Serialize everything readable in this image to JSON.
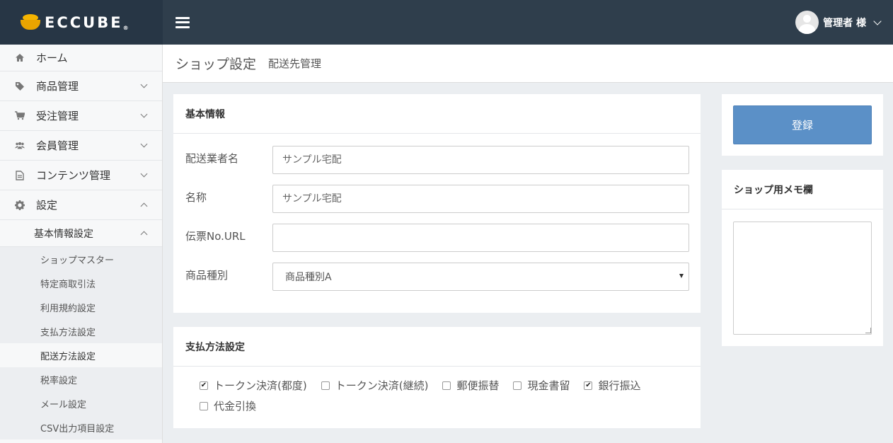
{
  "header": {
    "brand": "ECCUBE",
    "brand_mark": "®",
    "user_label": "管理者 様"
  },
  "sidebar": {
    "items": [
      {
        "label": "ホーム",
        "icon": "home-icon"
      },
      {
        "label": "商品管理",
        "icon": "tag-icon"
      },
      {
        "label": "受注管理",
        "icon": "cart-icon"
      },
      {
        "label": "会員管理",
        "icon": "users-icon"
      },
      {
        "label": "コンテンツ管理",
        "icon": "file-icon"
      },
      {
        "label": "設定",
        "icon": "gear-icon"
      }
    ],
    "sub_head": "基本情報設定",
    "sub_items": [
      {
        "label": "ショップマスター"
      },
      {
        "label": "特定商取引法"
      },
      {
        "label": "利用規約設定"
      },
      {
        "label": "支払方法設定"
      },
      {
        "label": "配送方法設定",
        "active": true
      },
      {
        "label": "税率設定"
      },
      {
        "label": "メール設定"
      },
      {
        "label": "CSV出力項目設定"
      }
    ]
  },
  "page": {
    "title": "ショップ設定",
    "subtitle": "配送先管理"
  },
  "basic_info": {
    "heading": "基本情報",
    "carrier_label": "配送業者名",
    "carrier_placeholder": "サンプル宅配",
    "name_label": "名称",
    "name_placeholder": "サンプル宅配",
    "tracking_label": "伝票No.URL",
    "tracking_value": "",
    "product_type_label": "商品種別",
    "product_type_selected": "商品種別A"
  },
  "payment": {
    "heading": "支払方法設定",
    "options": [
      {
        "label": "トークン決済(都度)",
        "checked": true
      },
      {
        "label": "トークン決済(継続)",
        "checked": false
      },
      {
        "label": "郵便振替",
        "checked": false
      },
      {
        "label": "現金書留",
        "checked": false
      },
      {
        "label": "銀行振込",
        "checked": true
      },
      {
        "label": "代金引換",
        "checked": false
      }
    ]
  },
  "side": {
    "register_label": "登録",
    "memo_heading": "ショップ用メモ欄",
    "memo_value": ""
  },
  "colors": {
    "header_bg": "#2f3e4c",
    "brand_bg": "#273645",
    "accent": "#5b90c7",
    "logo_yellow": "#f5b400"
  }
}
